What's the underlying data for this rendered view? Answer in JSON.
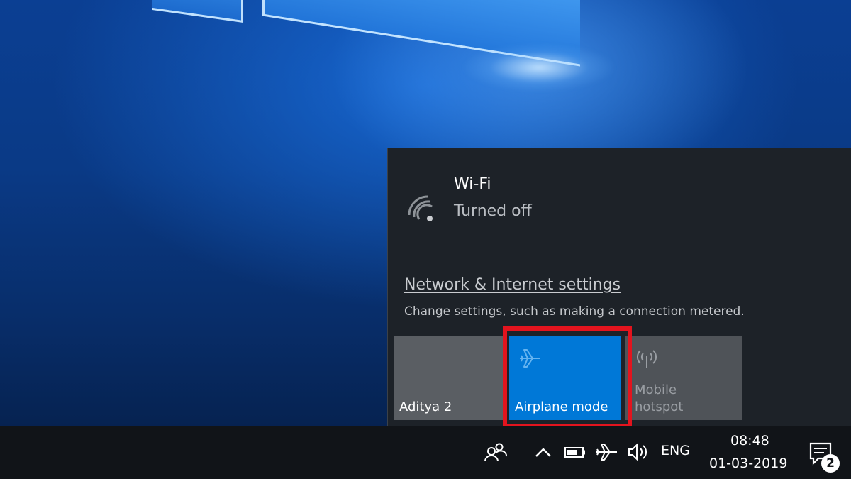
{
  "wifi": {
    "title": "Wi-Fi",
    "status": "Turned off",
    "icon": "wifi-off-icon"
  },
  "network_settings": {
    "link_label": "Network & Internet settings",
    "description": "Change settings, such as making a connection metered."
  },
  "quick_actions": [
    {
      "label": "Aditya 2",
      "icon": "none",
      "state": "off"
    },
    {
      "label": "Airplane mode",
      "icon": "airplane-icon",
      "state": "on"
    },
    {
      "label_line1": "Mobile",
      "label_line2": "hotspot",
      "icon": "mobile-hotspot-icon",
      "state": "disabled"
    }
  ],
  "taskbar": {
    "language": "ENG",
    "time": "08:48",
    "date": "01-03-2019",
    "notification_count": "2"
  },
  "colors": {
    "accent": "#0078d7",
    "highlight_border": "#e3141e",
    "flyout_bg": "#1d2228",
    "taskbar_bg": "#111418"
  }
}
